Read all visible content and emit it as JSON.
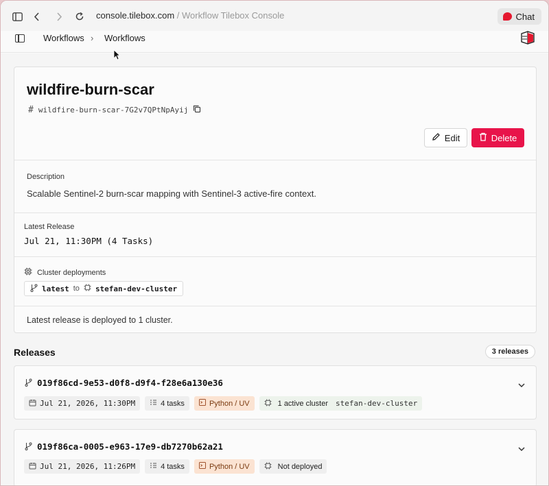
{
  "browser": {
    "url_host": "console.tilebox.com",
    "url_sep": " / ",
    "page_title": "Workflow Tilebox Console",
    "chat_label": "Chat"
  },
  "header": {
    "breadcrumb": [
      "Workflows",
      "Workflows"
    ],
    "crumb_separator": "›"
  },
  "workflow": {
    "title": "wildfire-burn-scar",
    "id_hash": "#",
    "id": "wildfire-burn-scar-7G2v7QPtNpAyij",
    "edit_label": "Edit",
    "delete_label": "Delete",
    "description_label": "Description",
    "description": "Scalable Sentinel-2 burn-scar mapping with Sentinel-3 active-fire context.",
    "latest_release_label": "Latest Release",
    "latest_release": "Jul 21, 11:30PM (4 Tasks)",
    "cluster_label": "Cluster deployments",
    "deployment": {
      "branch": "latest",
      "to": "to",
      "cluster": "stefan-dev-cluster"
    },
    "footer_note": "Latest release is deployed to 1 cluster."
  },
  "releases": {
    "title": "Releases",
    "count_label": "3 releases",
    "items": [
      {
        "id": "019f86cd-9e53-d0f8-d9f4-f28e6a130e36",
        "date": "Jul 21, 2026, 11:30PM",
        "tasks": "4 tasks",
        "runtime": "Python / UV",
        "status": "1 active cluster",
        "cluster": "stefan-dev-cluster"
      },
      {
        "id": "019f86ca-0005-e963-17e9-db7270b62a21",
        "date": "Jul 21, 2026, 11:26PM",
        "tasks": "4 tasks",
        "runtime": "Python / UV",
        "status": "Not deployed",
        "cluster": ""
      }
    ]
  },
  "colors": {
    "accent_red": "#e8144a",
    "runtime_chip": "#fbe3d2"
  }
}
